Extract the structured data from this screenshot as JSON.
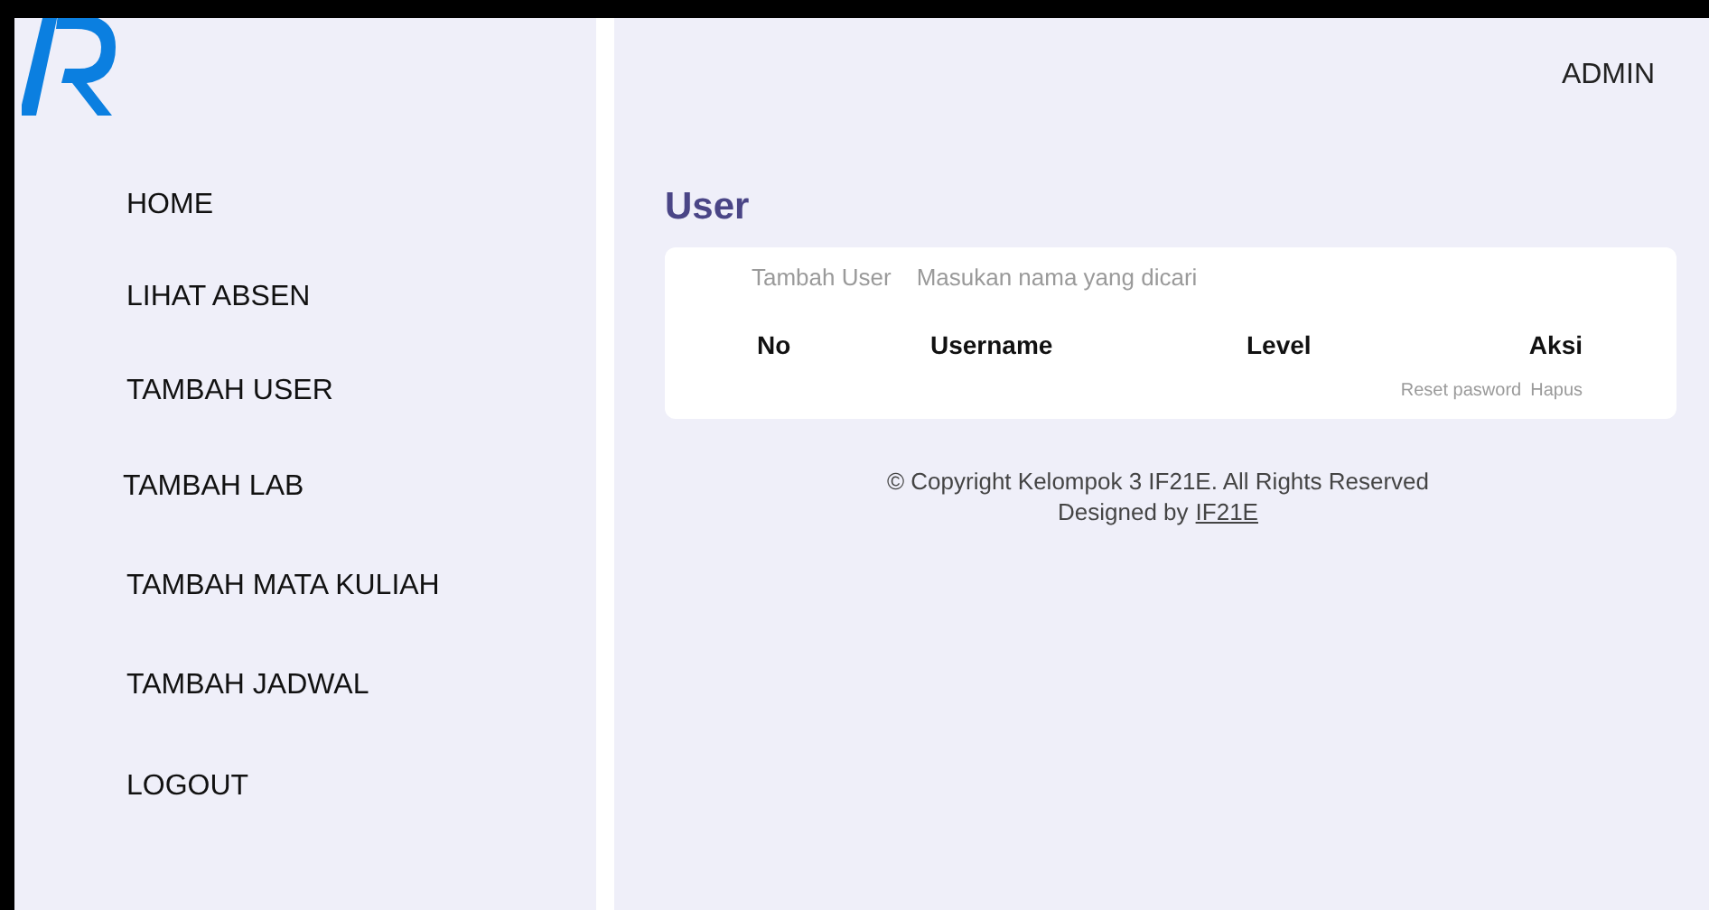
{
  "sidebar": {
    "items": [
      {
        "label": "HOME"
      },
      {
        "label": "LIHAT ABSEN"
      },
      {
        "label": "TAMBAH USER"
      },
      {
        "label": "TAMBAH LAB"
      },
      {
        "label": "TAMBAH MATA KULIAH"
      },
      {
        "label": "TAMBAH JADWAL"
      },
      {
        "label": "LOGOUT"
      }
    ]
  },
  "header": {
    "user": "ADMIN"
  },
  "page_title": "User",
  "toolbar": {
    "add_button": "Tambah User",
    "search": {
      "placeholder": "Masukan nama yang dicari"
    }
  },
  "table": {
    "columns": [
      "No",
      "Username",
      "Level",
      "Aksi"
    ],
    "actions": [
      "Reset pasword",
      "Hapus"
    ]
  },
  "footer": {
    "copyright": "© Copyright Kelompok 3 IF21E. All Rights Reserved",
    "designed_by": "Designed by",
    "designer_link": "IF21E"
  }
}
